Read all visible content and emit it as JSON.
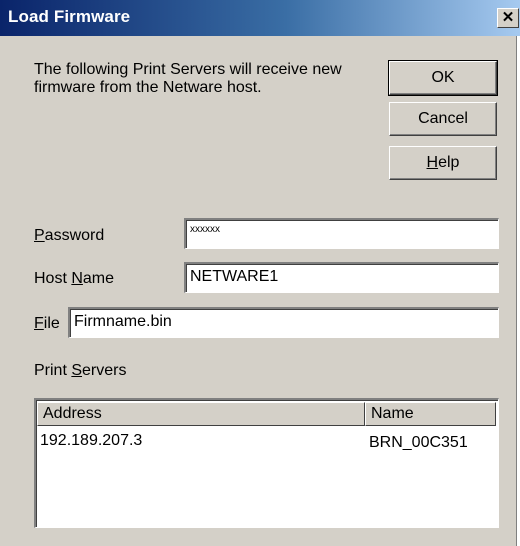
{
  "dialog": {
    "title": "Load Firmware",
    "close_glyph": "✕",
    "description": "The following Print Servers will receive new\nfirmware from the Netware host."
  },
  "buttons": {
    "ok": "OK",
    "cancel": "Cancel",
    "help_mnemonic": "H",
    "help_rest": "elp"
  },
  "fields": {
    "password": {
      "label_mnemonic": "P",
      "label_rest": "assword",
      "value": "xxxxxx"
    },
    "host_name": {
      "label_first": "Host ",
      "label_mnemonic": "N",
      "label_rest": "ame",
      "value": "NETWARE1"
    },
    "file": {
      "label_mnemonic": "F",
      "label_rest": "ile",
      "value": "Firmname.bin"
    }
  },
  "print_servers": {
    "label_first": "Print ",
    "label_mnemonic": "S",
    "label_rest": "ervers",
    "columns": [
      "Address",
      "Name"
    ],
    "rows": [
      {
        "address": "192.189.207.3",
        "name": "BRN_00C351"
      }
    ]
  },
  "icons": {
    "close": "close-icon"
  }
}
